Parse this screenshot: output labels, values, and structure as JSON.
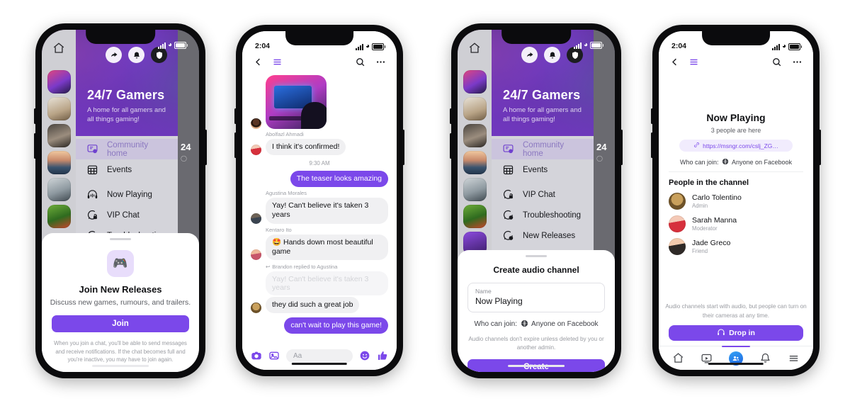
{
  "status_bar": {
    "time": "2:04",
    "icons": [
      "signal-bars",
      "wifi",
      "battery"
    ]
  },
  "phone1": {
    "community": {
      "title": "24/7 Gamers",
      "description": "A home for all gamers and all things gaming!",
      "header_actions": [
        "share-icon",
        "bell-icon",
        "shield-icon"
      ],
      "nav_items": [
        {
          "label": "Community home",
          "icon": "community-home-icon",
          "active": true
        },
        {
          "label": "Events",
          "icon": "calendar-icon",
          "active": false
        },
        {
          "label": "Now Playing",
          "icon": "headphones-icon",
          "active": false
        },
        {
          "label": "VIP Chat",
          "icon": "chat-lock-icon",
          "active": false
        },
        {
          "label": "Troubleshooting",
          "icon": "chat-audio-icon",
          "active": false
        }
      ],
      "peek_title": "24"
    },
    "join_sheet": {
      "icon": "game-controller-icon",
      "title": "Join New Releases",
      "subtitle": "Discuss new games, rumours, and trailers.",
      "button_label": "Join",
      "footnote": "When you join a chat, you'll be able to send messages and receive notifications. If the chat becomes full and you're inactive, you may have to join again."
    }
  },
  "phone2": {
    "header": {
      "back": "back-chevron-icon",
      "menu": "hamburger-icon",
      "search": "search-icon",
      "more": "more-dots-icon"
    },
    "messages": [
      {
        "type": "photo",
        "sender": "",
        "avatar": "av-a",
        "text": ""
      },
      {
        "type": "text",
        "sender": "Abolfazl Ahmadi",
        "avatar": "av-b",
        "text": "I think it's confirmed!",
        "side": "left"
      },
      {
        "type": "timestamp",
        "text": "9:30 AM"
      },
      {
        "type": "text",
        "sender": "",
        "avatar": "",
        "text": "The teaser looks amazing",
        "side": "right"
      },
      {
        "type": "text",
        "sender": "Agustina Morales",
        "avatar": "av-c",
        "text": "Yay! Can't believe it's taken 3 years",
        "side": "left"
      },
      {
        "type": "text",
        "sender": "Kentaro Ito",
        "avatar": "av-d",
        "text": "🤩 Hands down most beautiful game",
        "side": "left"
      },
      {
        "type": "reply",
        "reply_label": "Brandon replied to Agustina",
        "quoted": "Yay! Can't believe it's taken 3 years",
        "avatar": "av-e",
        "text": "they did such a great job",
        "side": "left"
      },
      {
        "type": "text",
        "sender": "",
        "avatar": "",
        "text": "can't wait to play this game!",
        "side": "right"
      }
    ],
    "composer": {
      "placeholder": "Aa",
      "camera_icon": "camera-icon",
      "gallery_icon": "gallery-icon",
      "emoji_icon": "emoji-icon",
      "like_icon": "thumbs-up-icon"
    }
  },
  "phone3": {
    "community": {
      "title": "24/7 Gamers",
      "description": "A home for all gamers and all things gaming!",
      "nav_items": [
        {
          "label": "Community home",
          "icon": "community-home-icon",
          "active": true
        },
        {
          "label": "Events",
          "icon": "calendar-icon",
          "active": false
        },
        {
          "label": "VIP Chat",
          "icon": "chat-lock-icon",
          "active": false
        },
        {
          "label": "Troubleshooting",
          "icon": "chat-audio-icon",
          "active": false
        },
        {
          "label": "New Releases",
          "icon": "chat-audio-icon",
          "active": false
        }
      ],
      "peek_title": "24"
    },
    "create_sheet": {
      "title": "Create audio channel",
      "field_label": "Name",
      "field_value": "Now Playing",
      "who_can_join_label": "Who can join:",
      "who_can_join_value": "Anyone on Facebook",
      "note": "Audio channels don't expire unless deleted by you or another admin.",
      "button_label": "Create"
    }
  },
  "phone4": {
    "header": {
      "back": "back-chevron-icon",
      "menu": "hamburger-icon",
      "search": "search-icon",
      "more": "more-dots-icon"
    },
    "channel": {
      "title": "Now Playing",
      "presence": "3 people are here",
      "invite_link": "https://msngr.com/cslj_ZG…",
      "who_can_join_label": "Who can join:",
      "who_can_join_value": "Anyone on Facebook",
      "people_heading": "People in the channel",
      "people": [
        {
          "name": "Carlo Tolentino",
          "role": "Admin",
          "avatar": "av-e"
        },
        {
          "name": "Sarah Manna",
          "role": "Moderator",
          "avatar": "av-b"
        },
        {
          "name": "Jade Greco",
          "role": "Friend",
          "avatar": "av-f"
        }
      ],
      "note": "Audio channels start with audio, but people can turn on their cameras at any time.",
      "drop_in_label": "Drop in",
      "drop_in_icon": "headphones-icon"
    },
    "tabbar": [
      {
        "icon": "home-icon",
        "active": false
      },
      {
        "icon": "watch-icon",
        "active": false
      },
      {
        "icon": "groups-icon",
        "active": true
      },
      {
        "icon": "bell-icon",
        "active": false
      },
      {
        "icon": "hamburger-icon",
        "active": false
      }
    ]
  },
  "colors": {
    "accent": "#7b48ea",
    "accent_soft": "#e8ddfb",
    "bubble": "#f0f0f2",
    "tab_active": "#1d62e0"
  }
}
